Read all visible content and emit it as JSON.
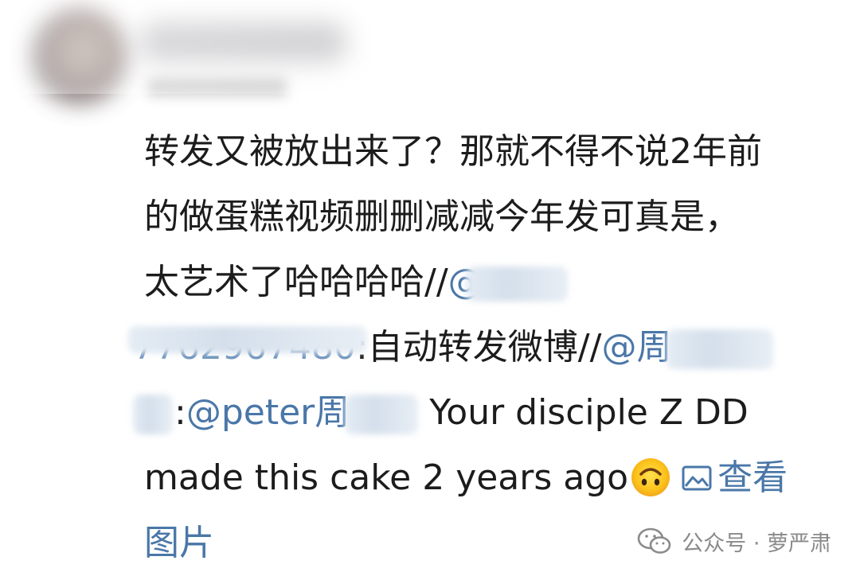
{
  "comment": {
    "line1": "转发又被放出来了？那就不得不说2年前",
    "line2": "的做蛋糕视频删删减减今年发可真是，",
    "line3_text": "太艺术了哈哈哈哈//",
    "line3_mention_visible": "@",
    "line4_mention_visible": "7762967480",
    "line4_text": ":自动转发微博//",
    "line4_mention2_visible": "@周",
    "line5_colon": ":",
    "line5_mention": "@peter周",
    "line5_text": " Your disciple Z DD",
    "line6_text": "made this cake 2 years ago",
    "view_pictures": "查看",
    "line7_text": "图片",
    "emoji": "upside-down-face",
    "link_color": "#4a77a8",
    "text_color": "#1c1c1c"
  },
  "watermark": {
    "text": "公众号 · 萝严肃",
    "icon": "wechat-icon"
  }
}
